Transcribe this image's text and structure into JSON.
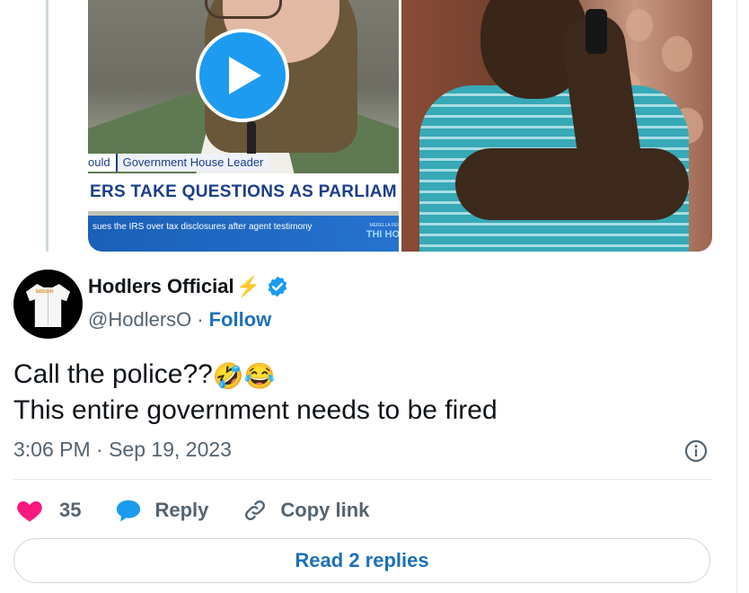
{
  "media": {
    "left": {
      "chyron_fragment": "ould",
      "chyron_label": "Government House Leader",
      "chyron_headline": "ERS TAKE QUESTIONS AS PARLIAM",
      "chyron_subline": "sues the IRS over tax disclosures after agent testimony",
      "chyron_tag": "MERELLA FER",
      "channel_logo": "THI HO"
    },
    "play_icon": "play-icon"
  },
  "author": {
    "display_name": "Hodlers Official",
    "emoji_suffix": "⚡",
    "handle": "@HodlersO",
    "separator": "·",
    "follow_label": "Follow",
    "verified_color": "#1d9bf0",
    "avatar_logo": "bitcoin"
  },
  "tweet": {
    "line1": "Call the police??",
    "line1_emojis": "🤣😂",
    "line2": "This entire government needs to be fired",
    "timestamp": "3:06 PM · Sep 19, 2023"
  },
  "actions": {
    "like_count": "35",
    "reply_label": "Reply",
    "copy_label": "Copy link",
    "like_color": "#f91880",
    "reply_color": "#1d9bf0"
  },
  "read_replies_label": "Read 2 replies"
}
